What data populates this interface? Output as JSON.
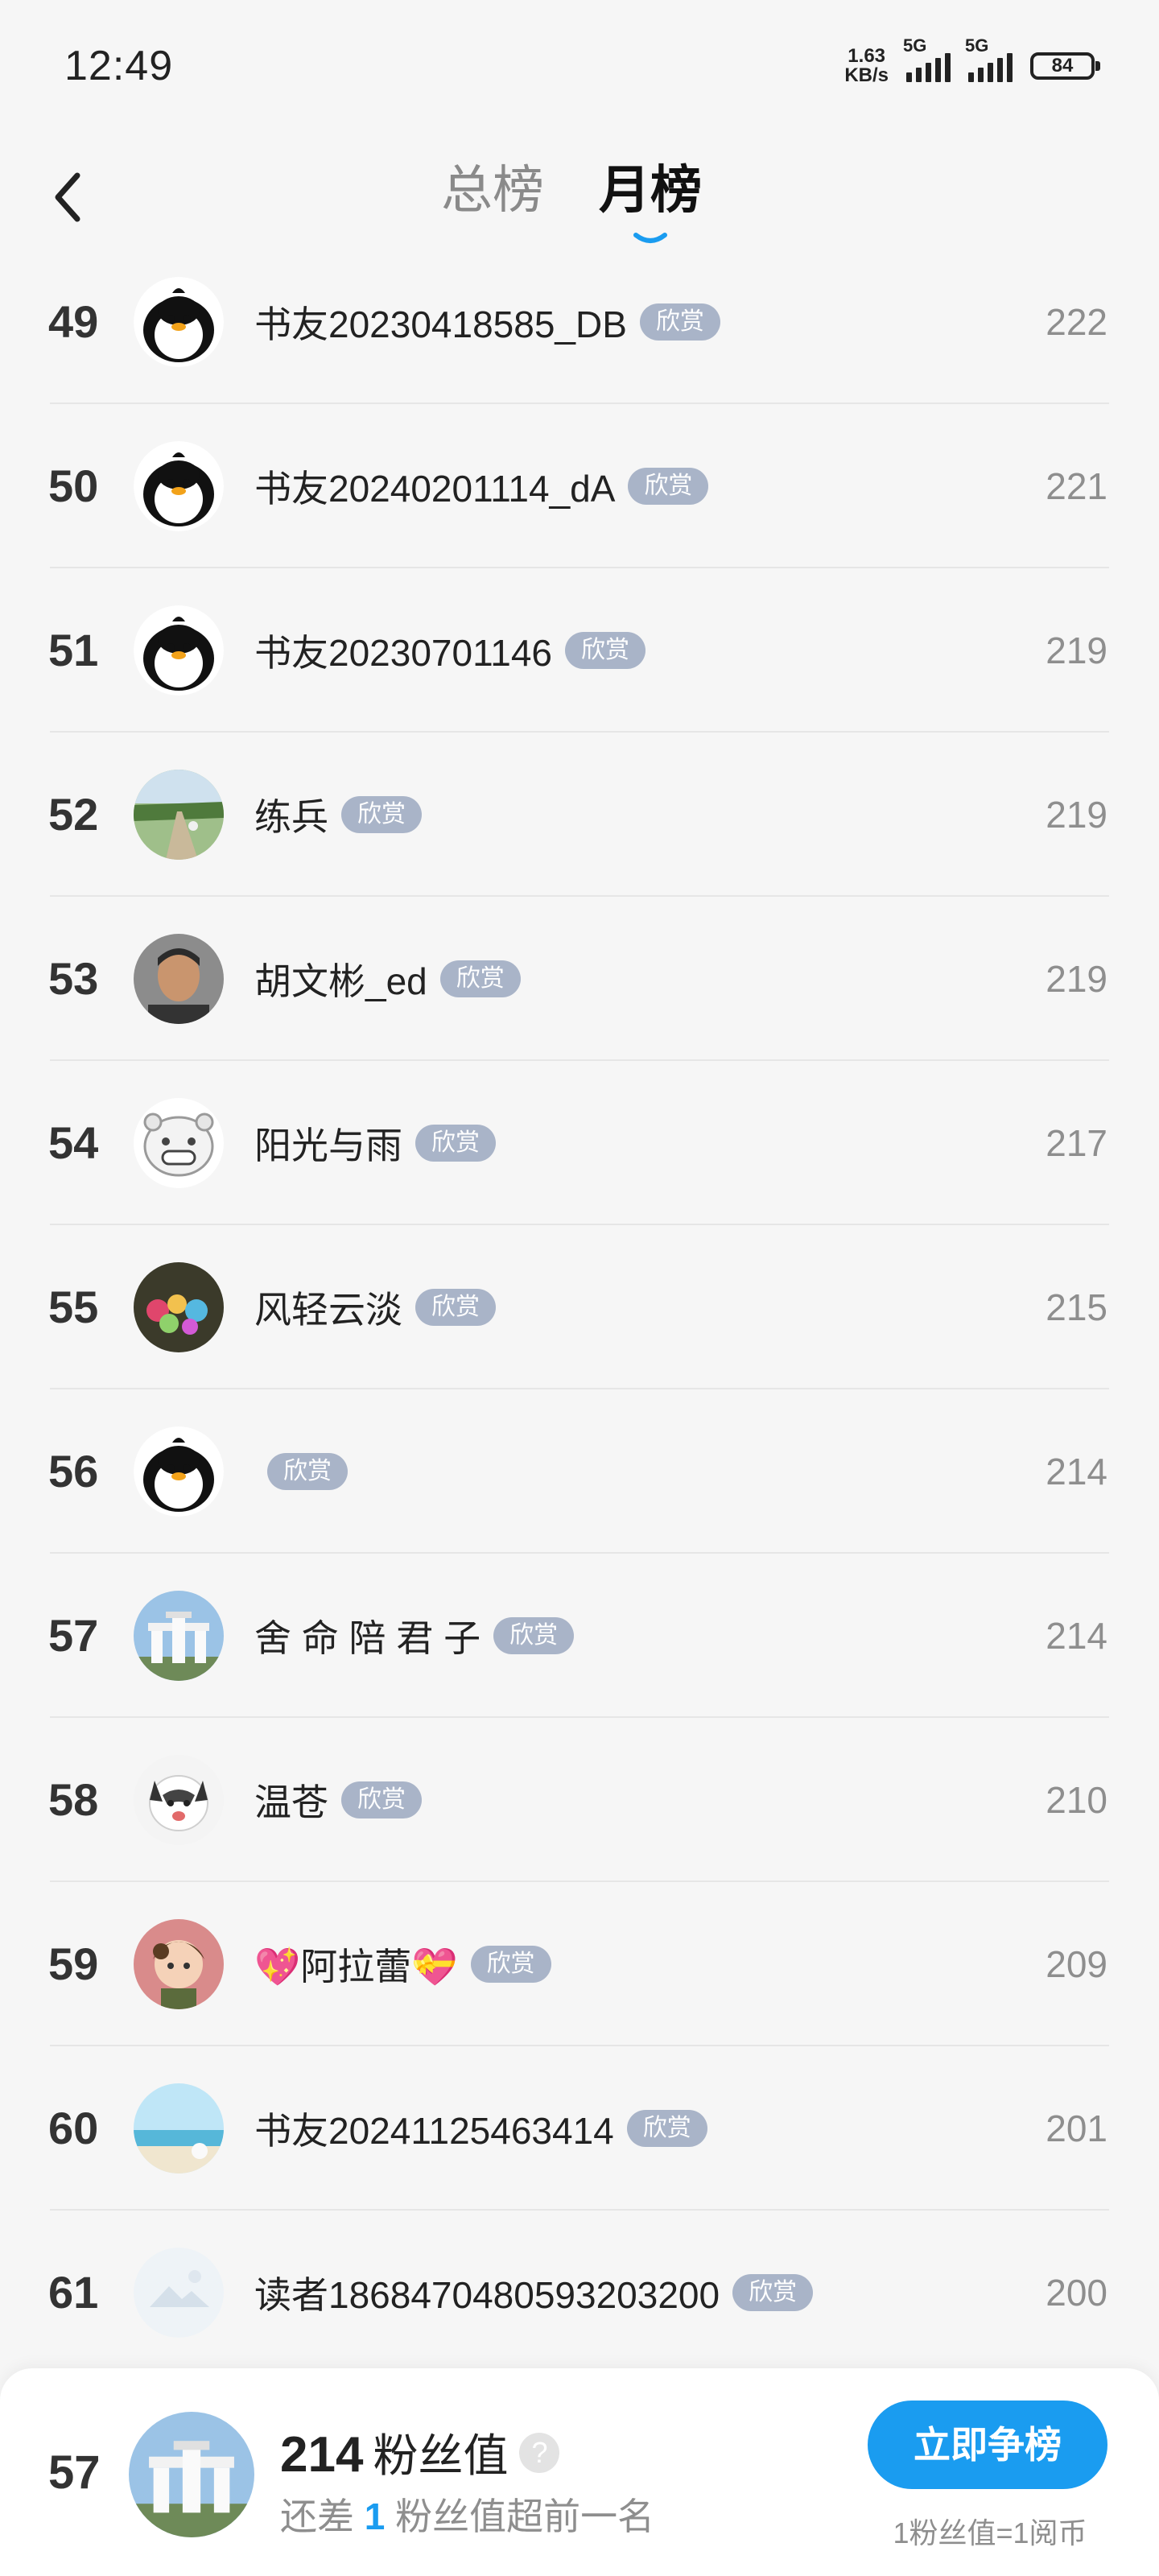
{
  "status_bar": {
    "time": "12:49",
    "net_speed_value": "1.63",
    "net_speed_unit": "KB/s",
    "sim1_label": "5G",
    "sim2_label": "5G",
    "battery": "84"
  },
  "header": {
    "tabs": [
      {
        "label": "总榜",
        "active": false
      },
      {
        "label": "月榜",
        "active": true
      }
    ]
  },
  "colors": {
    "accent": "#1a9cf0",
    "badge": "#a9b4c8",
    "score_text": "#8e8e8e"
  },
  "list": [
    {
      "rank": "49",
      "name": "书友20230418585_DB",
      "badge": "欣赏",
      "score": "222",
      "avatar": "penguin-avatar"
    },
    {
      "rank": "50",
      "name": "书友20240201114_dA",
      "badge": "欣赏",
      "score": "221",
      "avatar": "penguin-avatar"
    },
    {
      "rank": "51",
      "name": "书友20230701146",
      "badge": "欣赏",
      "score": "219",
      "avatar": "penguin-avatar"
    },
    {
      "rank": "52",
      "name": "练兵",
      "badge": "欣赏",
      "score": "219",
      "avatar": "road-photo-avatar"
    },
    {
      "rank": "53",
      "name": "胡文彬_ed",
      "badge": "欣赏",
      "score": "219",
      "avatar": "person-photo-avatar"
    },
    {
      "rank": "54",
      "name": "阳光与雨",
      "badge": "欣赏",
      "score": "217",
      "avatar": "cartoon-face-avatar"
    },
    {
      "rank": "55",
      "name": "风轻云淡",
      "badge": "欣赏",
      "score": "215",
      "avatar": "flowers-photo-avatar"
    },
    {
      "rank": "56",
      "name": "",
      "badge": "欣赏",
      "score": "214",
      "avatar": "penguin-avatar"
    },
    {
      "rank": "57",
      "name": "舍 命 陪 君 子",
      "badge": "欣赏",
      "score": "214",
      "avatar": "gate-photo-avatar"
    },
    {
      "rank": "58",
      "name": "温苍",
      "badge": "欣赏",
      "score": "210",
      "avatar": "husky-photo-avatar"
    },
    {
      "rank": "59",
      "name": "💖阿拉蕾💝",
      "badge": "欣赏",
      "score": "209",
      "avatar": "cartoon-girl-avatar"
    },
    {
      "rank": "60",
      "name": "书友20241125463414",
      "badge": "欣赏",
      "score": "201",
      "avatar": "beach-photo-avatar"
    },
    {
      "rank": "61",
      "name": "读者1868470480593203200",
      "badge": "欣赏",
      "score": "200",
      "avatar": "default-avatar"
    }
  ],
  "bottom_bar": {
    "my_rank": "57",
    "my_score": "214",
    "my_score_unit": "粉丝值",
    "help_icon": "?",
    "gap_prefix": "还差",
    "gap_value": "1",
    "gap_suffix": "粉丝值超前一名",
    "compete_label": "立即争榜",
    "exchange_note": "1粉丝值=1阅币"
  }
}
